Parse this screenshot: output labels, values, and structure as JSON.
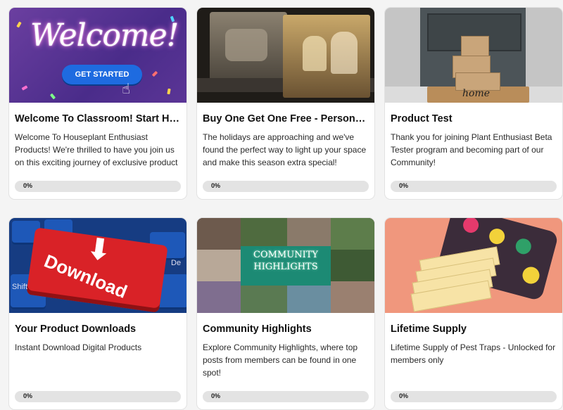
{
  "cards": [
    {
      "title": "Welcome To Classroom! Start Here",
      "description": "Welcome To Houseplant Enthusiast Products! We're thrilled to have you join us on this exciting journey of exclusive product",
      "progress_label": "0%",
      "progress": 0,
      "image_text": {
        "headline": "Welcome!",
        "button": "GET STARTED"
      }
    },
    {
      "title": "Buy One Get One Free - Personalized",
      "description": "The holidays are approaching and we've found the perfect way to light up your space and make this season extra special! Imagine",
      "progress_label": "0%",
      "progress": 0
    },
    {
      "title": "Product Test",
      "description": "Thank you for joining Plant Enthusiast Beta Tester program and becoming part of our Community!",
      "progress_label": "0%",
      "progress": 0,
      "image_text": {
        "mat": "home"
      }
    },
    {
      "title": "Your Product Downloads",
      "description": "Instant Download Digital Products",
      "progress_label": "0%",
      "progress": 0,
      "image_text": {
        "key": "Download",
        "shift": "Shift",
        "side": "De"
      }
    },
    {
      "title": "Community Highlights",
      "description": "Explore Community Highlights, where top posts from members can be found in one spot!",
      "progress_label": "0%",
      "progress": 0,
      "image_text": {
        "sign_line1": "COMMUNITY",
        "sign_line2": "HIGHLIGHTS"
      }
    },
    {
      "title": "Lifetime Supply",
      "description": "Lifetime Supply of Pest Traps - Unlocked for members only",
      "progress_label": "0%",
      "progress": 0
    }
  ],
  "colors": {
    "progress_track": "#e3e3e3",
    "accent": "#1e6be0"
  }
}
